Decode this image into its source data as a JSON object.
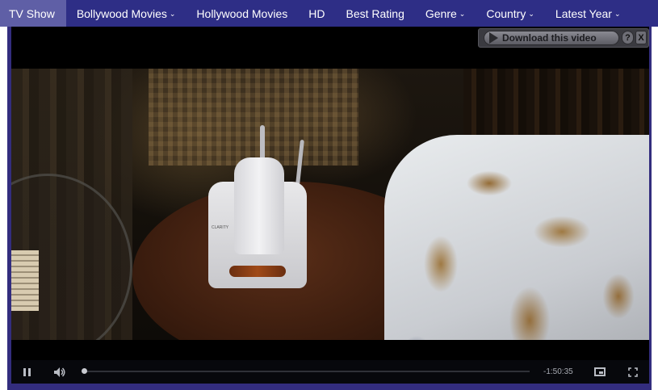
{
  "nav": {
    "items": [
      {
        "label": "TV Show",
        "chevron": ""
      },
      {
        "label": "Bollywood Movies",
        "chevron": "⌄"
      },
      {
        "label": "Hollywood Movies",
        "chevron": ""
      },
      {
        "label": "HD",
        "chevron": ""
      },
      {
        "label": "Best Rating",
        "chevron": ""
      },
      {
        "label": "Genre",
        "chevron": "⌄"
      },
      {
        "label": "Country",
        "chevron": "⌄"
      },
      {
        "label": "Latest Year",
        "chevron": "⌄"
      }
    ],
    "active_index": 0,
    "background": "#2e2e86",
    "active_background": "#5f5fa6"
  },
  "download": {
    "label": "Download this video",
    "help": "?",
    "close": "X"
  },
  "scene": {
    "phone_brand": "CLARITY"
  },
  "player": {
    "time_remaining": "-1:50:35",
    "progress_fraction": 0.0,
    "accent": "#332d7e"
  }
}
